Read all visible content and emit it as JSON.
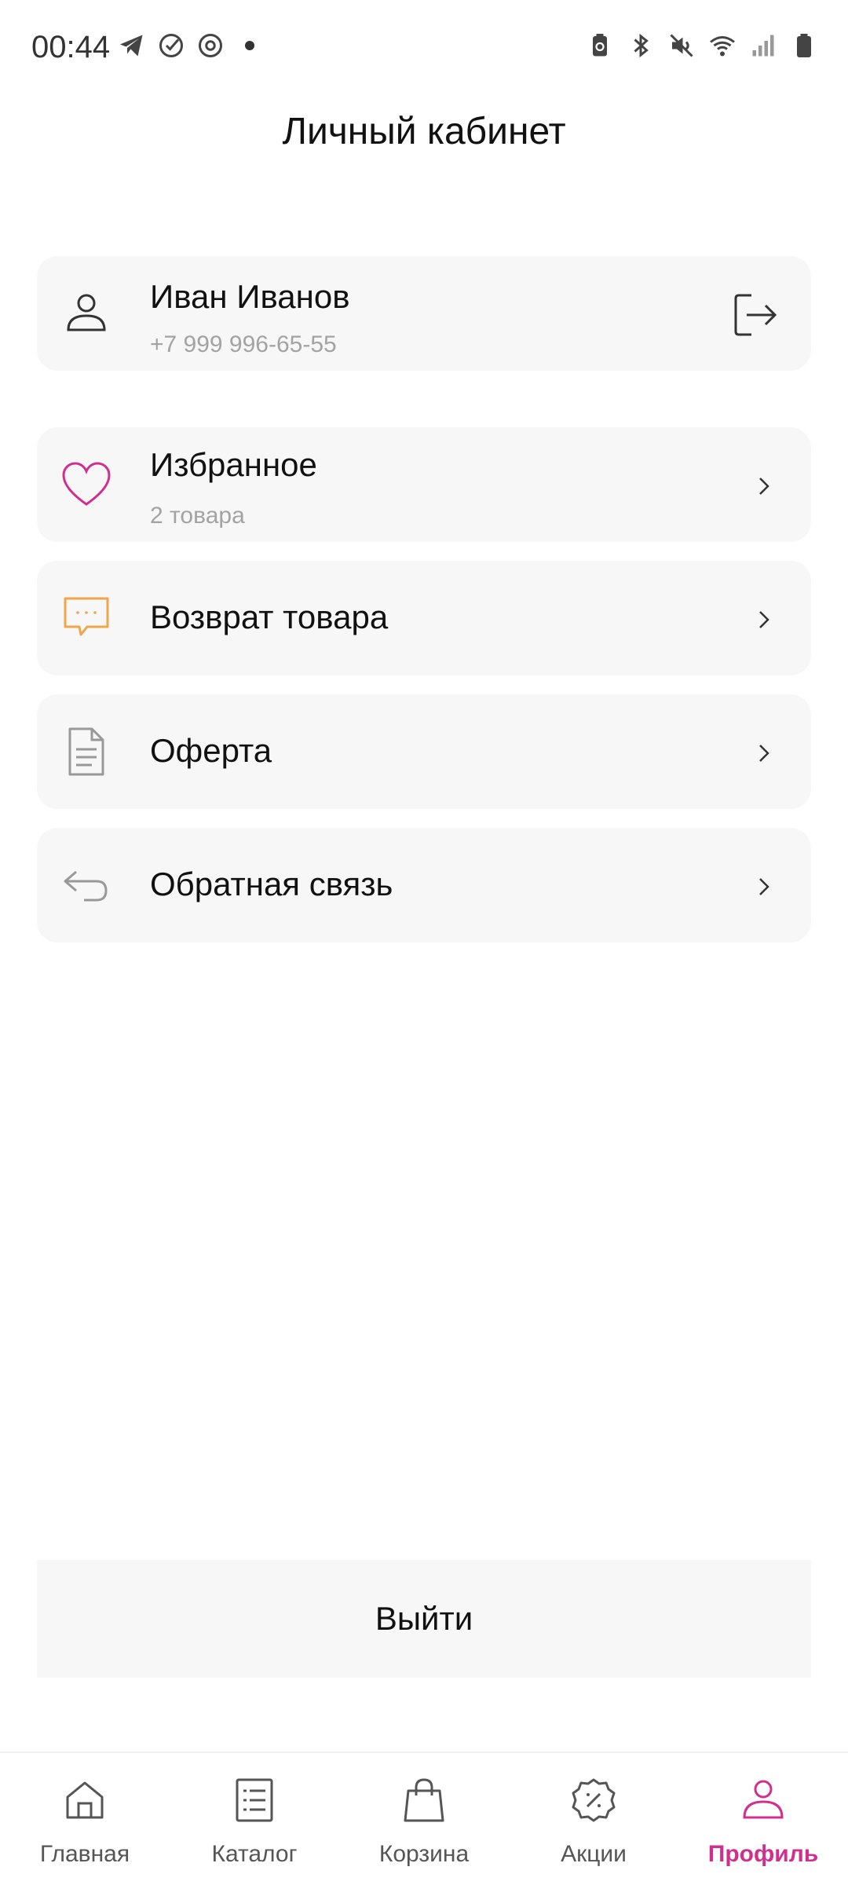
{
  "status_bar": {
    "time": "00:44",
    "left_icons": [
      "telegram-icon",
      "check-circle-icon",
      "sync-icon",
      "dot-icon"
    ],
    "right_icons": [
      "battery-saver-icon",
      "bluetooth-icon",
      "mute-icon",
      "wifi-icon",
      "signal-icon",
      "battery-icon"
    ]
  },
  "page": {
    "title": "Личный кабинет"
  },
  "profile": {
    "name": "Иван Иванов",
    "phone": "+7 999 996-65-55",
    "icon": "user-icon",
    "action_icon": "logout-icon"
  },
  "menu": {
    "favorites": {
      "label": "Избранное",
      "sub": "2 товара",
      "icon": "heart-icon"
    },
    "returns": {
      "label": "Возврат товара",
      "icon": "chat-bubble-icon"
    },
    "offer": {
      "label": "Оферта",
      "icon": "document-icon"
    },
    "feedback": {
      "label": "Обратная связь",
      "icon": "reply-icon"
    }
  },
  "exit_button": {
    "label": "Выйти"
  },
  "bottom_nav": {
    "items": [
      {
        "label": "Главная",
        "icon": "home-icon",
        "active": false
      },
      {
        "label": "Каталог",
        "icon": "catalog-icon",
        "active": false
      },
      {
        "label": "Корзина",
        "icon": "bag-icon",
        "active": false
      },
      {
        "label": "Акции",
        "icon": "discount-icon",
        "active": false
      },
      {
        "label": "Профиль",
        "icon": "user-icon",
        "active": true
      }
    ]
  },
  "colors": {
    "accent": "#d02f8e",
    "card_bg": "#f7f7f7",
    "secondary_text": "#a3a3a3",
    "chat_icon": "#f0a64a"
  }
}
